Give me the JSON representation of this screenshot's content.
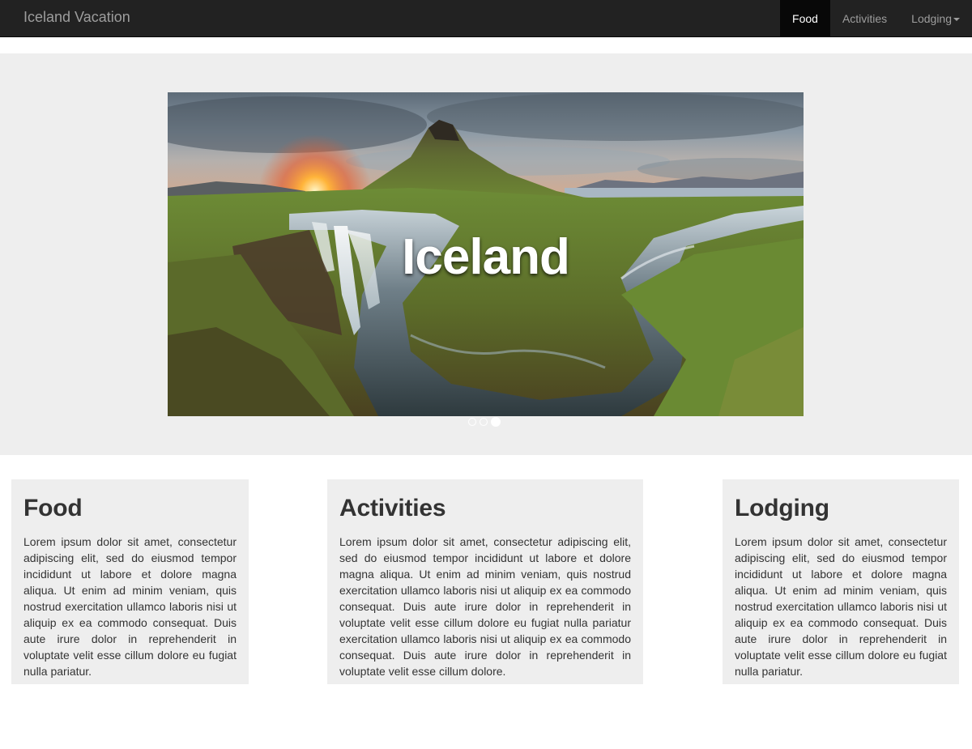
{
  "navbar": {
    "brand": "Iceland Vacation",
    "items": [
      {
        "label": "Food",
        "active": true
      },
      {
        "label": "Activities",
        "active": false
      },
      {
        "label": "Lodging",
        "active": false,
        "dropdown": true
      }
    ]
  },
  "carousel": {
    "caption": "Iceland",
    "slide_count": 3,
    "active_slide": 3,
    "image_icon": "landscape-photo"
  },
  "panels": [
    {
      "title": "Food",
      "text": "Lorem ipsum dolor sit amet, consectetur adipiscing elit, sed do eiusmod tempor incididunt ut labore et dolore magna aliqua. Ut enim ad minim veniam, quis nostrud exercitation ullamco laboris nisi ut aliquip ex ea commodo consequat. Duis aute irure dolor in reprehenderit in voluptate velit esse cillum dolore eu fugiat nulla pariatur."
    },
    {
      "title": "Activities",
      "text": "Lorem ipsum dolor sit amet, consectetur adipiscing elit, sed do eiusmod tempor incididunt ut labore et dolore magna aliqua. Ut enim ad minim veniam, quis nostrud exercitation ullamco laboris nisi ut aliquip ex ea commodo consequat. Duis aute irure dolor in reprehenderit in voluptate velit esse cillum dolore eu fugiat nulla pariatur exercitation ullamco laboris nisi ut aliquip ex ea commodo consequat. Duis aute irure dolor in reprehenderit in voluptate velit esse cillum dolore."
    },
    {
      "title": "Lodging",
      "text": "Lorem ipsum dolor sit amet, consectetur adipiscing elit, sed do eiusmod tempor incididunt ut labore et dolore magna aliqua. Ut enim ad minim veniam, quis nostrud exercitation ullamco laboris nisi ut aliquip ex ea commodo consequat. Duis aute irure dolor in reprehenderit in voluptate velit esse cillum dolore eu fugiat nulla pariatur."
    }
  ],
  "colors": {
    "navbar_bg": "#222222",
    "nav_active_bg": "#080808",
    "jumbotron_bg": "#eeeeee",
    "panel_bg": "#eeeeee",
    "text": "#333333"
  }
}
